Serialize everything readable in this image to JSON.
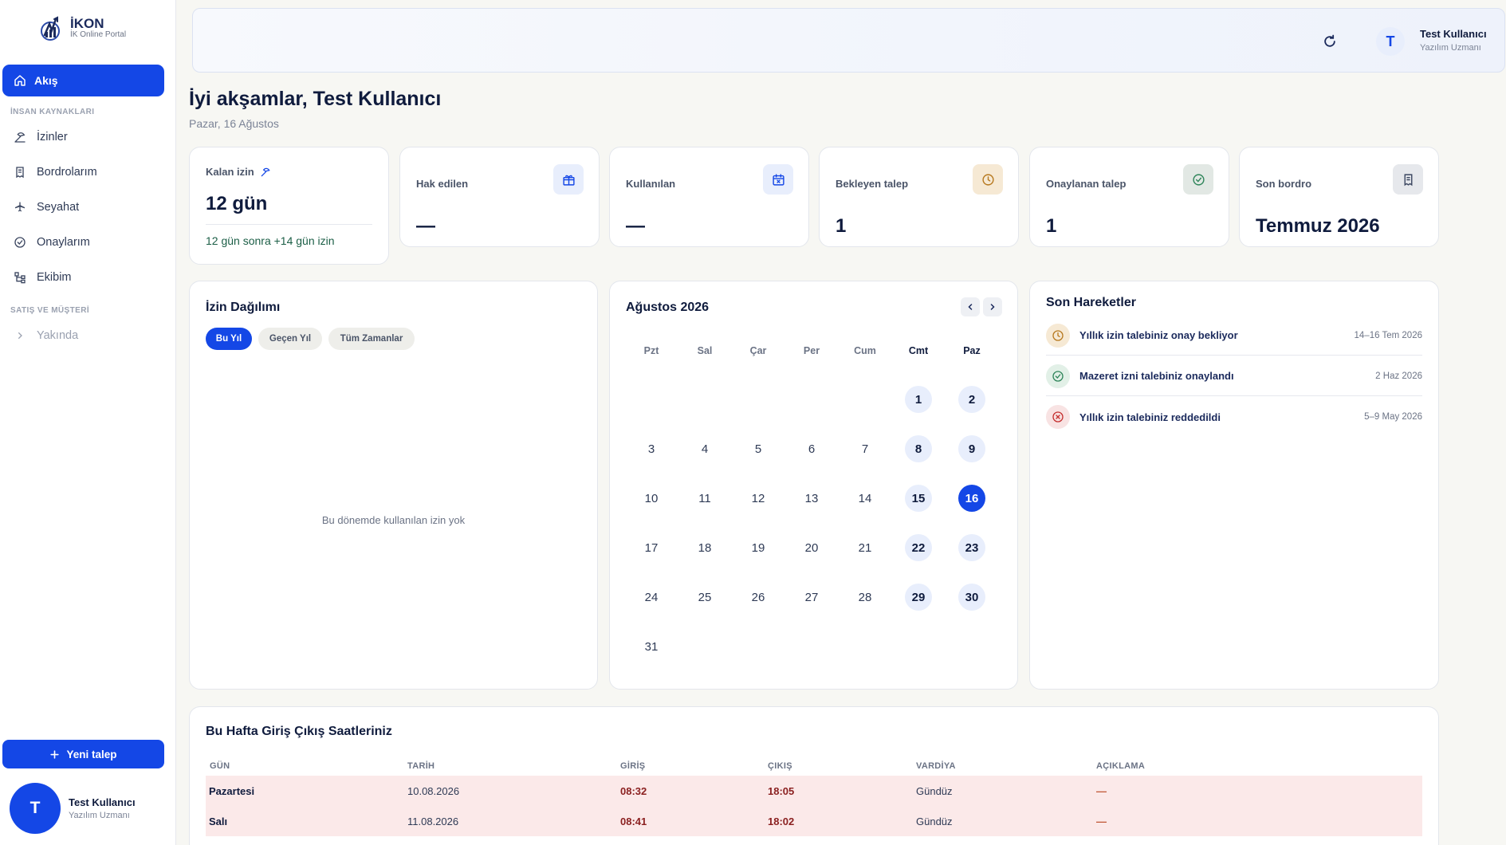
{
  "brand": {
    "name": "İKON",
    "subtitle": "İK Online Portal"
  },
  "sidebar": {
    "active_item": {
      "label": "Akış",
      "icon": "home-icon"
    },
    "sections": [
      {
        "label": "İNSAN KAYNAKLARI",
        "items": [
          {
            "label": "İzinler",
            "icon": "beach-icon"
          },
          {
            "label": "Bordrolarım",
            "icon": "receipt-icon"
          },
          {
            "label": "Seyahat",
            "icon": "plane-icon"
          },
          {
            "label": "Onaylarım",
            "icon": "check-circle-icon"
          },
          {
            "label": "Ekibim",
            "icon": "org-chart-icon"
          }
        ]
      },
      {
        "label": "SATIŞ VE MÜŞTERİ",
        "items": [
          {
            "label": "Yakında",
            "icon": "chevron-right-icon"
          }
        ]
      }
    ],
    "new_request_label": "Yeni talep",
    "user": {
      "initial": "T",
      "name": "Test Kullanıcı",
      "role": "Yazılım Uzmanı"
    }
  },
  "topbar": {
    "user": {
      "initial": "T",
      "name": "Test Kullanıcı",
      "role": "Yazılım Uzmanı"
    }
  },
  "header": {
    "greeting": "İyi akşamlar, Test Kullanıcı",
    "date": "Pazar, 16 Ağustos"
  },
  "stats": {
    "remaining": {
      "label": "Kalan izin",
      "value": "12 gün",
      "note": "12 gün sonra +14 gün izin"
    },
    "earned": {
      "label": "Hak edilen",
      "value": "—"
    },
    "used": {
      "label": "Kullanılan",
      "value": "—"
    },
    "pending": {
      "label": "Bekleyen talep",
      "value": "1"
    },
    "approved": {
      "label": "Onaylanan talep",
      "value": "1"
    },
    "payslip": {
      "label": "Son bordro",
      "value": "Temmuz 2026"
    }
  },
  "leave_distribution": {
    "title": "İzin Dağılımı",
    "filters": [
      "Bu Yıl",
      "Geçen Yıl",
      "Tüm Zamanlar"
    ],
    "selected_filter": "Bu Yıl",
    "empty_text": "Bu dönemde kullanılan izin yok"
  },
  "calendar": {
    "title": "Ağustos 2026",
    "weekdays": [
      "Pzt",
      "Sal",
      "Çar",
      "Per",
      "Cum",
      "Cmt",
      "Paz"
    ],
    "first_weekday_index": 5,
    "days_in_month": 31,
    "today": 16
  },
  "activity": {
    "title": "Son Hareketler",
    "items": [
      {
        "text": "Yıllık izin talebiniz onay bekliyor",
        "date": "14–16 Tem 2026",
        "status": "pending",
        "icon": "clock-icon"
      },
      {
        "text": "Mazeret izni talebiniz onaylandı",
        "date": "2 Haz 2026",
        "status": "approved",
        "icon": "check-circle-icon"
      },
      {
        "text": "Yıllık izin talebiniz reddedildi",
        "date": "5–9 May 2026",
        "status": "rejected",
        "icon": "x-circle-icon"
      }
    ]
  },
  "attendance": {
    "title": "Bu Hafta Giriş Çıkış Saatleriniz",
    "columns": [
      "GÜN",
      "TARİH",
      "GİRİŞ",
      "ÇIKIŞ",
      "VARDİYA",
      "AÇIKLAMA"
    ],
    "rows": [
      {
        "day": "Pazartesi",
        "date": "10.08.2026",
        "in": "08:32",
        "out": "18:05",
        "shift": "Gündüz",
        "note": "—"
      },
      {
        "day": "Salı",
        "date": "11.08.2026",
        "in": "08:41",
        "out": "18:02",
        "shift": "Gündüz",
        "note": "—"
      }
    ]
  },
  "colors": {
    "primary": "#1447e6",
    "pending": "#b7791f",
    "approved": "#2f855a",
    "rejected": "#c53030",
    "row_highlight": "#fbe9e9"
  }
}
